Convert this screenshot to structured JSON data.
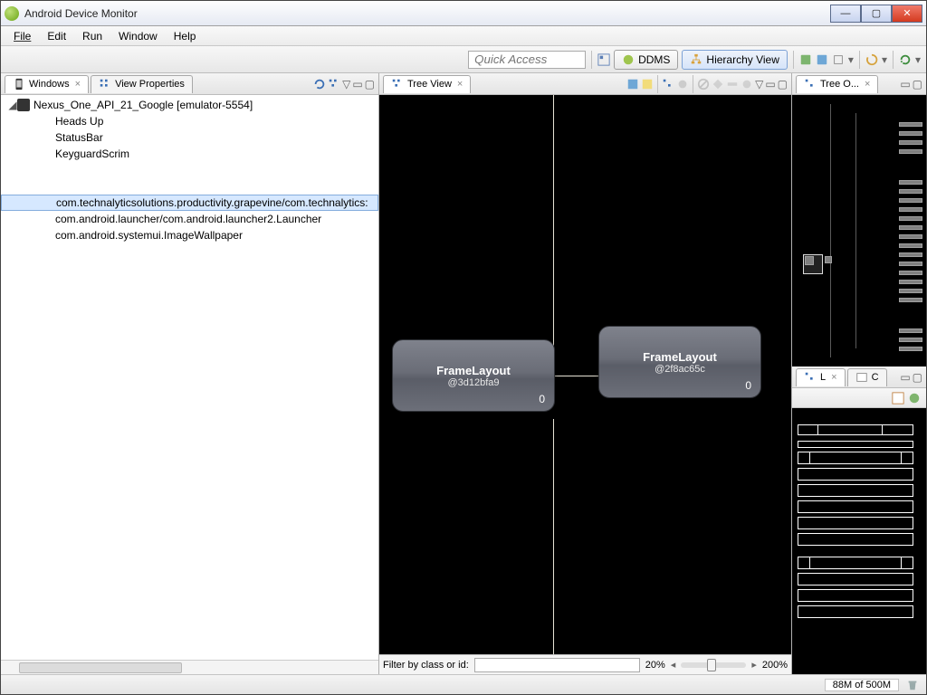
{
  "window_title": "Android Device Monitor",
  "menubar": [
    "File",
    "Edit",
    "Run",
    "Window",
    "Help"
  ],
  "quick_access_placeholder": "Quick Access",
  "perspectives": {
    "ddms": "DDMS",
    "hierarchy": "Hierarchy View"
  },
  "left_pane": {
    "tab_windows": "Windows",
    "tab_viewprops": "View Properties",
    "device": "Nexus_One_API_21_Google [emulator-5554]",
    "sysui": [
      "Heads Up",
      "StatusBar",
      "KeyguardScrim"
    ],
    "processes": [
      "com.technalyticsolutions.productivity.grapevine/com.technalytics:",
      "com.android.launcher/com.android.launcher2.Launcher",
      "com.android.systemui.ImageWallpaper"
    ]
  },
  "treeview": {
    "tab_label": "Tree View",
    "nodes": [
      {
        "class": "FrameLayout",
        "id": "@3d12bfa9",
        "count": "0"
      },
      {
        "class": "FrameLayout",
        "id": "@2f8ac65c",
        "count": "0"
      }
    ],
    "filter_label": "Filter by class or id:",
    "zoom_min": "20%",
    "zoom_max": "200%"
  },
  "right": {
    "overview_tab": "Tree O...",
    "tab_l": "L",
    "tab_c": "C"
  },
  "status": {
    "heap": "88M of 500M"
  }
}
